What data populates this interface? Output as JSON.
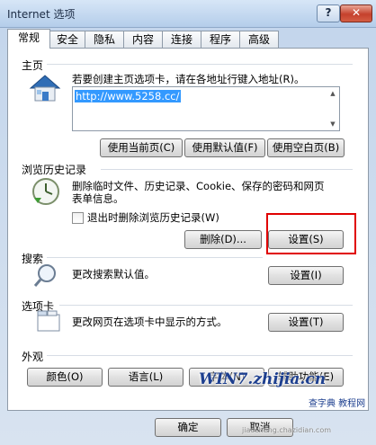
{
  "window": {
    "title": "Internet 选项",
    "help": "?",
    "close": "✕"
  },
  "tabs": [
    "常规",
    "安全",
    "隐私",
    "内容",
    "连接",
    "程序",
    "高级"
  ],
  "home": {
    "label": "主页",
    "description": "若要创建主页选项卡，请在各地址行键入地址(R)。",
    "url": "http://www.5258.cc/",
    "buttons": [
      "使用当前页(C)",
      "使用默认值(F)",
      "使用空白页(B)"
    ]
  },
  "history": {
    "label": "浏览历史记录",
    "description_line1": "删除临时文件、历史记录、Cookie、保存的密码和网页",
    "description_line2": "表单信息。",
    "checkbox_label": "退出时删除浏览历史记录(W)",
    "delete_button": "删除(D)...",
    "settings_button": "设置(S)"
  },
  "search": {
    "label": "搜索",
    "description": "更改搜索默认值。",
    "settings_button": "设置(I)"
  },
  "tabs_section": {
    "label": "选项卡",
    "description": "更改网页在选项卡中显示的方式。",
    "settings_button": "设置(T)"
  },
  "appearance": {
    "label": "外观",
    "buttons": [
      "颜色(O)",
      "语言(L)",
      "字体(N)",
      "辅助功能(E)"
    ]
  },
  "footer": {
    "ok": "确定",
    "cancel": "取消"
  },
  "watermark": {
    "logo": "WIN7.zhijia.cn",
    "sub": "查字典 教程网",
    "site": "jiaocheng.chazidian.com"
  }
}
